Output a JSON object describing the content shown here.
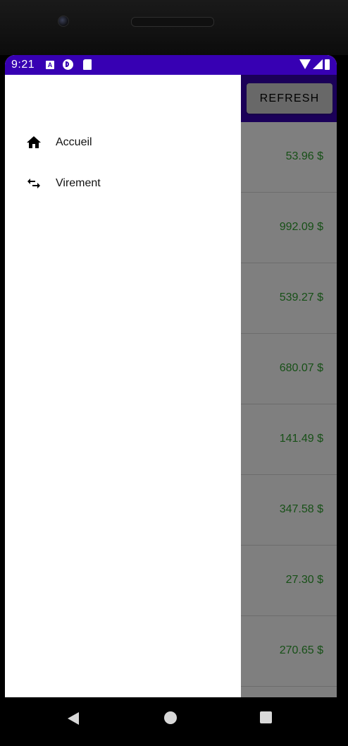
{
  "status_bar": {
    "time": "9:21",
    "icons": [
      "notification-a-icon",
      "notification-p-icon",
      "sd-card-icon",
      "wifi-icon",
      "signal-icon",
      "battery-icon"
    ],
    "background": "#3700b3"
  },
  "toolbar": {
    "refresh_label": "REFRESH"
  },
  "drawer": {
    "items": [
      {
        "label": "Accueil",
        "icon": "home-icon"
      },
      {
        "label": "Virement",
        "icon": "transfer-icon"
      }
    ]
  },
  "transactions": {
    "amounts": [
      "53.96 $",
      "992.09 $",
      "539.27 $",
      "680.07 $",
      "141.49 $",
      "347.58 $",
      "27.30 $",
      "270.65 $"
    ],
    "amount_color": "#2ea02e"
  },
  "navigation_bar": {
    "buttons": [
      "back-icon",
      "home-circle-icon",
      "recents-icon"
    ]
  }
}
